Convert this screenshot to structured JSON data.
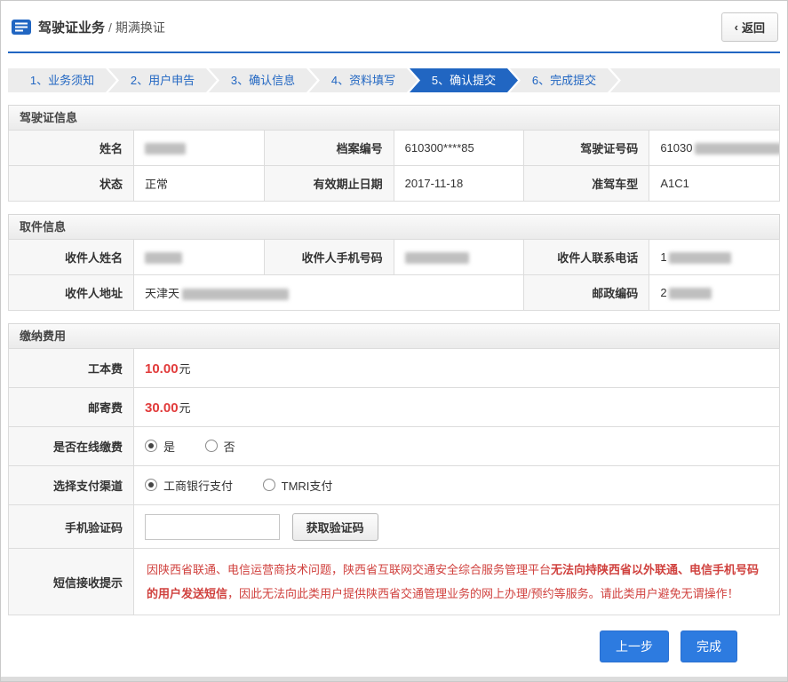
{
  "colors": {
    "accent_blue": "#2166c2",
    "button_blue": "#2d7be0",
    "price_red": "#e13b3b",
    "notice_red": "#d0413e"
  },
  "header": {
    "title_main": "驾驶证业务",
    "title_sep": "/",
    "title_sub": "期满换证",
    "back_chevron": "‹",
    "back_label": "返回"
  },
  "steps": [
    {
      "label": "1、业务须知",
      "active": false
    },
    {
      "label": "2、用户申告",
      "active": false
    },
    {
      "label": "3、确认信息",
      "active": false
    },
    {
      "label": "4、资料填写",
      "active": false
    },
    {
      "label": "5、确认提交",
      "active": true
    },
    {
      "label": "6、完成提交",
      "active": false
    }
  ],
  "license": {
    "title": "驾驶证信息",
    "name_label": "姓名",
    "name_value": "",
    "file_no_label": "档案编号",
    "file_no_value": "610300****85",
    "license_no_label": "驾驶证号码",
    "license_no_value": "61030",
    "status_label": "状态",
    "status_value": "正常",
    "expiry_label": "有效期止日期",
    "expiry_value": "2017-11-18",
    "vehicle_label": "准驾车型",
    "vehicle_value": "A1C1"
  },
  "pickup": {
    "title": "取件信息",
    "recipient_label": "收件人姓名",
    "recipient_value": "",
    "mobile_label": "收件人手机号码",
    "mobile_value": "",
    "phone_label": "收件人联系电话",
    "phone_value": "1",
    "address_label": "收件人地址",
    "address_value": "天津天",
    "zip_label": "邮政编码",
    "zip_value": "2"
  },
  "payment": {
    "title": "缴纳费用",
    "fee_label": "工本费",
    "fee_value": "10.00",
    "fee_unit": "元",
    "postage_label": "邮寄费",
    "postage_value": "30.00",
    "postage_unit": "元",
    "online_label": "是否在线缴费",
    "online_yes": "是",
    "online_no": "否",
    "online_selected": "是",
    "channel_label": "选择支付渠道",
    "channel_icbc": "工商银行支付",
    "channel_tmri": "TMRI支付",
    "channel_selected": "工商银行支付",
    "sms_label": "手机验证码",
    "sms_input_value": "",
    "sms_button": "获取验证码",
    "notice_label": "短信接收提示",
    "notice_part1": "因陕西省联通、电信运营商技术问题，陕西省互联网交通安全综合服务管理平台",
    "notice_part2": "无法向持陕西省以外联通、电信手机号码的用户发送短信",
    "notice_part3": "，因此无法向此类用户提供陕西省交通管理业务的网上办理/预约等服务。请此类用户避免无谓操作！"
  },
  "footer": {
    "prev_label": "上一步",
    "done_label": "完成"
  }
}
